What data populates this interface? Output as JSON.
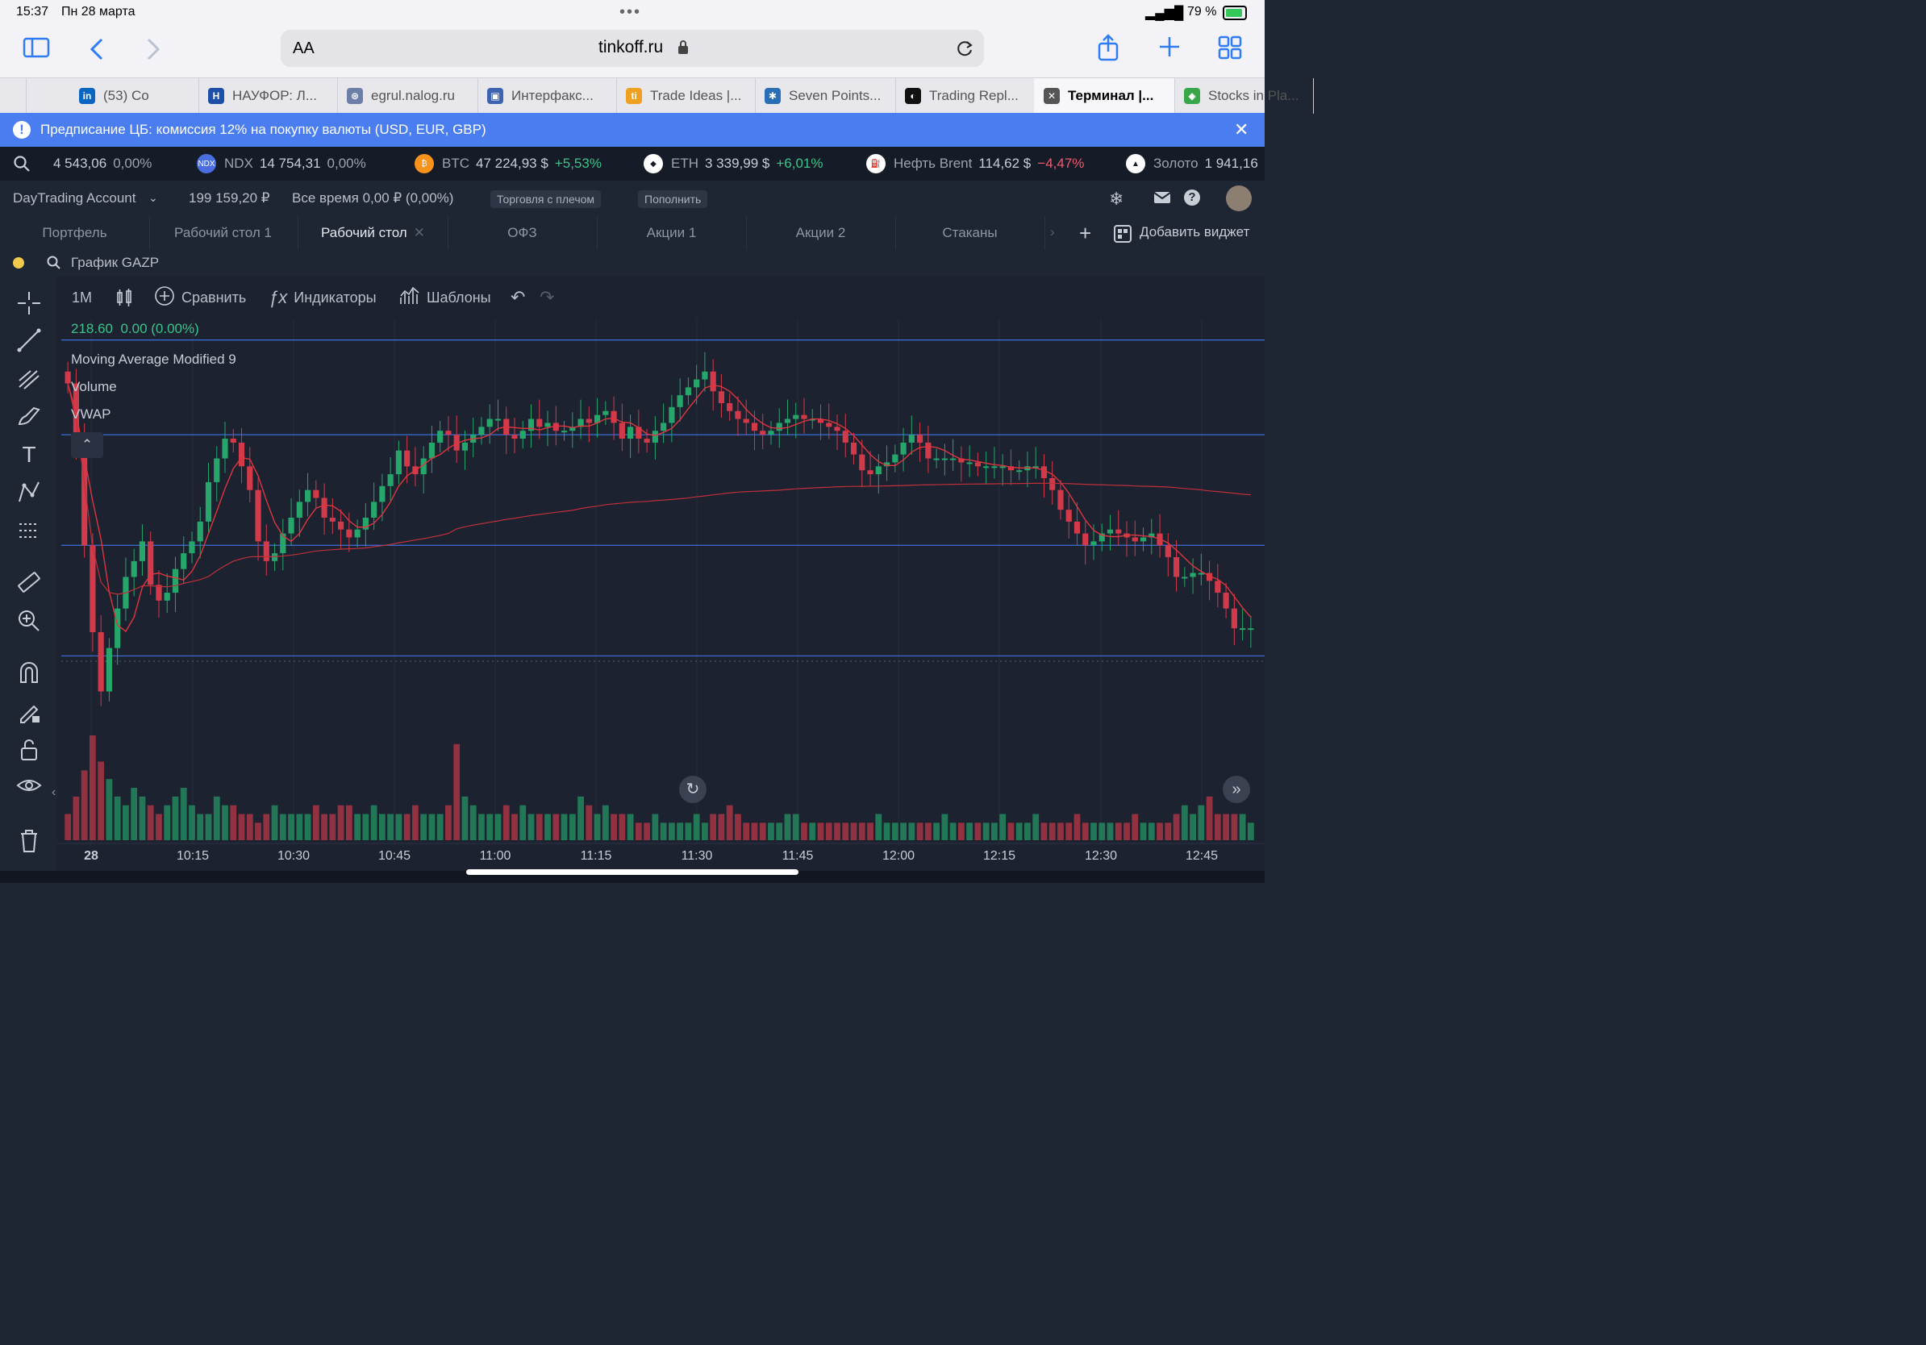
{
  "status": {
    "time": "15:37",
    "date": "Пн 28 марта",
    "battery": "79 %"
  },
  "browser": {
    "url_text": "tinkoff.ru",
    "aa": "AA"
  },
  "tabs": [
    {
      "label": "(53) Со",
      "icon": "linkedin-icon",
      "color": "#0a66c2",
      "fav": "in"
    },
    {
      "label": "НАУФОР: Л...",
      "icon": "naufor-icon",
      "color": "#1e4fa8",
      "fav": "H"
    },
    {
      "label": "egrul.nalog.ru",
      "icon": "nalog-icon",
      "color": "#6b7fa8",
      "fav": "⊛"
    },
    {
      "label": "Интерфакс...",
      "icon": "interfax-icon",
      "color": "#3e63b0",
      "fav": "▣"
    },
    {
      "label": "Trade Ideas |...",
      "icon": "tradeideas-icon",
      "color": "#f0a020",
      "fav": "ti"
    },
    {
      "label": "Seven Points...",
      "icon": "sevenpoints-icon",
      "color": "#2a6fb5",
      "fav": "✱"
    },
    {
      "label": "Trading Repl...",
      "icon": "tradingreplay-icon",
      "color": "#111",
      "fav": "◐"
    },
    {
      "label": "Терминал |...",
      "icon": "close-icon",
      "color": "#555",
      "fav": "✕",
      "active": true
    },
    {
      "label": "Stocks in Pla...",
      "icon": "shield-icon",
      "color": "#3aa64a",
      "fav": "◆"
    }
  ],
  "banner": {
    "text": "Предписание ЦБ: комиссия 12% на покупку валюты (USD, EUR, GBP)"
  },
  "ticker": [
    {
      "name": "",
      "price": "4 543,06",
      "change": "0,00%",
      "cls": ""
    },
    {
      "name": "NDX",
      "price": "14 754,31",
      "change": "0,00%",
      "cls": "",
      "icon": "NDX",
      "color": "#4a6ee0"
    },
    {
      "name": "BTC",
      "price": "47 224,93 $",
      "change": "+5,53%",
      "cls": "pos",
      "icon": "₿",
      "color": "#f7931a"
    },
    {
      "name": "ETH",
      "price": "3 339,99 $",
      "change": "+6,01%",
      "cls": "pos",
      "icon": "◆",
      "color": "#ffffff"
    },
    {
      "name": "Нефть Brent",
      "price": "114,62 $",
      "change": "−4,47%",
      "cls": "neg",
      "icon": "⛽",
      "color": "#ffffff"
    },
    {
      "name": "Золото",
      "price": "1 941,16",
      "change": "",
      "cls": "",
      "icon": "▲",
      "color": "#ffffff"
    }
  ],
  "account": {
    "name": "DayTrading Account",
    "balance": "199 159,20 ₽",
    "period": "Все время 0,00 ₽ (0,00%)",
    "margin_btn": "Торговля с плечом",
    "deposit_btn": "Пополнить"
  },
  "workspace_tabs": [
    "Портфель",
    "Рабочий стол 1",
    "Рабочий стол",
    "ОФЗ",
    "Акции 1",
    "Акции 2",
    "Стаканы"
  ],
  "add_widget": "Добавить виджет",
  "widget": {
    "title": "График GAZP"
  },
  "toolbar": {
    "interval": "1M",
    "compare": "Сравнить",
    "indicators": "Индикаторы",
    "templates": "Шаблоны"
  },
  "legend": {
    "price": "218.60",
    "change": "0.00 (0.00%)",
    "ma": "Moving Average Modified 9",
    "volume": "Volume",
    "vwap": "VWAP"
  },
  "colors": {
    "up": "#26a66b",
    "down": "#d23a4a",
    "ma": "#e0353f",
    "hline": "#3d6fd8",
    "banner": "#4a7ef0"
  },
  "chart_data": {
    "type": "candlestick",
    "x_ticks": [
      "28",
      "10:15",
      "10:30",
      "10:45",
      "11:00",
      "11:15",
      "11:30",
      "11:45",
      "12:00",
      "12:15",
      "12:30",
      "12:45"
    ],
    "h_lines": [
      219.4,
      217.0,
      214.2,
      211.4
    ],
    "candles_close": [
      218.3,
      216.8,
      214.2,
      212.0,
      210.5,
      211.6,
      212.6,
      213.4,
      213.8,
      214.3,
      213.2,
      212.8,
      213.0,
      213.6,
      214.0,
      214.3,
      214.8,
      215.8,
      216.4,
      216.9,
      216.8,
      216.2,
      215.6,
      214.3,
      213.8,
      214.0,
      214.5,
      214.9,
      215.3,
      215.6,
      215.4,
      214.9,
      214.8,
      214.6,
      214.4,
      214.6,
      214.9,
      215.3,
      215.7,
      216.0,
      216.6,
      216.2,
      216.0,
      216.4,
      216.8,
      217.1,
      217.0,
      216.6,
      216.8,
      217.0,
      217.2,
      217.4,
      217.4,
      217.0,
      216.9,
      217.1,
      217.4,
      217.2,
      217.3,
      217.1,
      217.1,
      217.2,
      217.4,
      217.3,
      217.5,
      217.6,
      217.3,
      216.9,
      217.2,
      216.9,
      216.8,
      217.1,
      217.3,
      217.7,
      218.0,
      218.2,
      218.4,
      218.6,
      218.1,
      217.8,
      217.6,
      217.4,
      217.3,
      217.1,
      217.0,
      217.1,
      217.3,
      217.4,
      217.5,
      217.4,
      217.4,
      217.3,
      217.2,
      217.1,
      216.8,
      216.5,
      216.1,
      216.0,
      216.2,
      216.3,
      216.5,
      216.8,
      217.0,
      216.8,
      216.4,
      216.4,
      216.4,
      216.4,
      216.3,
      216.3,
      216.2,
      216.2,
      216.2,
      216.2,
      216.1,
      216.1,
      216.2,
      216.2,
      215.9,
      215.6,
      215.1,
      214.8,
      214.5,
      214.2,
      214.3,
      214.5,
      214.6,
      214.5,
      214.4,
      214.3,
      214.4,
      214.5,
      214.2,
      213.9,
      213.4,
      213.4,
      213.5,
      213.5,
      213.3,
      213.0,
      212.6,
      212.1,
      212.1,
      212.1
    ],
    "volume": [
      3,
      5,
      8,
      12,
      9,
      7,
      5,
      4,
      6,
      5,
      4,
      3,
      4,
      5,
      6,
      4,
      3,
      3,
      5,
      4,
      4,
      3,
      3,
      2,
      3,
      4,
      3,
      3,
      3,
      3,
      4,
      3,
      3,
      4,
      4,
      3,
      3,
      4,
      3,
      3,
      3,
      3,
      4,
      3,
      3,
      3,
      4,
      11,
      5,
      4,
      3,
      3,
      3,
      4,
      3,
      4,
      3,
      3,
      3,
      3,
      3,
      3,
      5,
      4,
      3,
      4,
      3,
      3,
      3,
      2,
      2,
      3,
      2,
      2,
      2,
      2,
      3,
      2,
      3,
      3,
      4,
      3,
      2,
      2,
      2,
      2,
      2,
      3,
      3,
      2,
      2,
      2,
      2,
      2,
      2,
      2,
      2,
      2,
      3,
      2,
      2,
      2,
      2,
      2,
      2,
      2,
      3,
      2,
      2,
      2,
      2,
      2,
      2,
      3,
      2,
      2,
      2,
      3,
      2,
      2,
      2,
      2,
      3,
      2,
      2,
      2,
      2,
      2,
      2,
      3,
      2,
      2,
      2,
      2,
      3,
      4,
      3,
      4,
      5,
      3,
      3,
      3,
      3
    ]
  }
}
